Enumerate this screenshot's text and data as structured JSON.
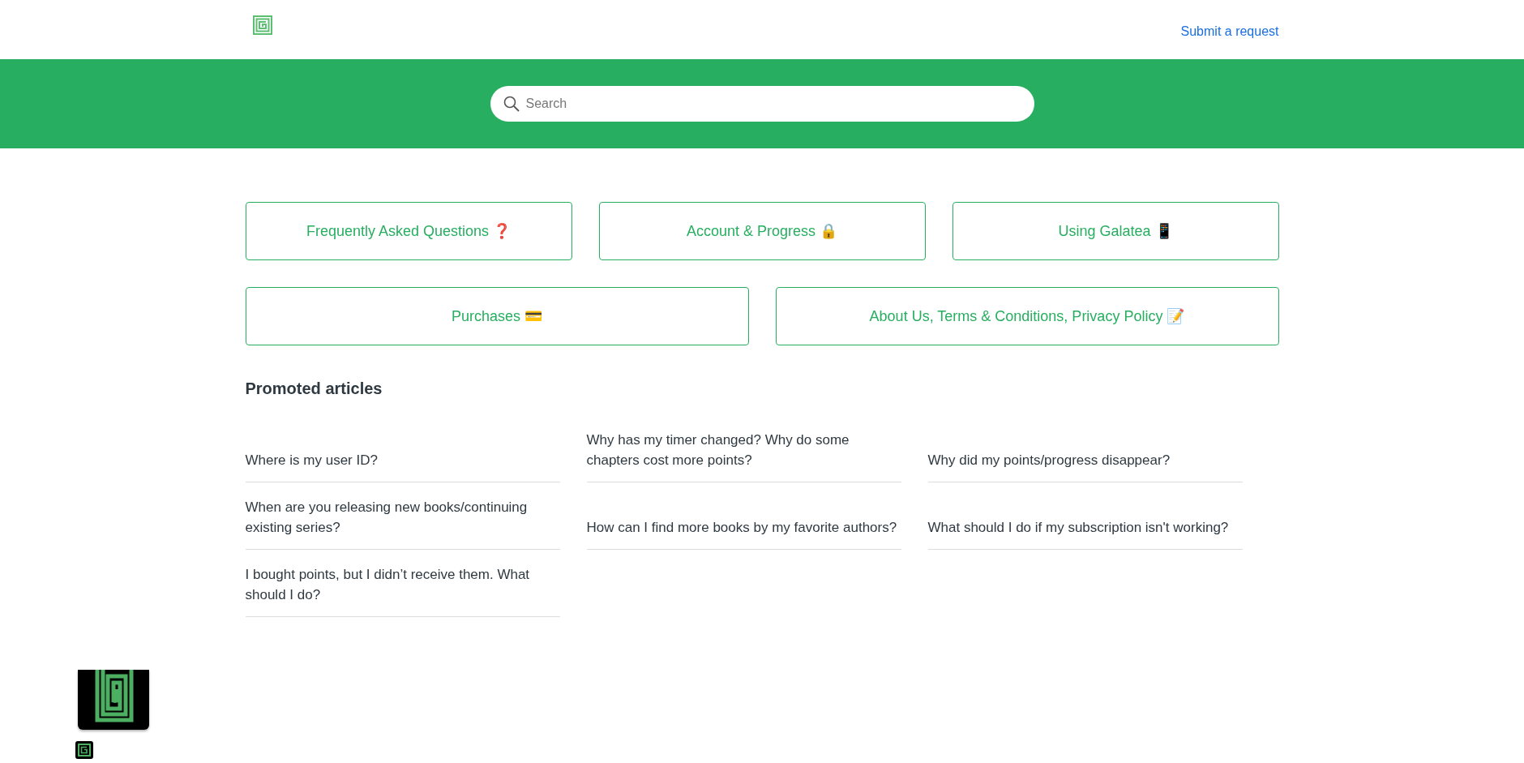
{
  "header": {
    "submit_link": "Submit a request"
  },
  "search": {
    "placeholder": "Search"
  },
  "category_rows": [
    [
      "Frequently Asked Questions ❓",
      "Account & Progress 🔒",
      "Using Galatea 📱"
    ],
    [
      "Purchases 💳",
      "About Us, Terms & Conditions, Privacy Policy 📝"
    ]
  ],
  "promoted": {
    "title": "Promoted articles",
    "articles": [
      "Where is my user ID?",
      "Why has my timer changed? Why do some chapters cost more points?",
      "Why did my points/progress disappear?",
      "When are you releasing new books/continuing existing series?",
      "How can I find more books by my favorite authors?",
      "What should I do if my subscription isn't working?",
      "I bought points, but I didn’t receive them. What should I do?"
    ]
  }
}
